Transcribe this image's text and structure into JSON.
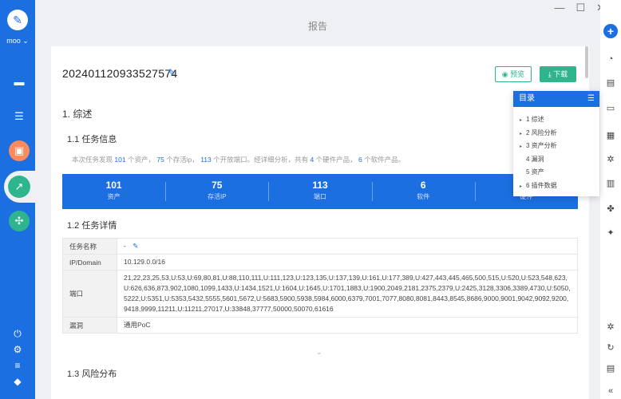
{
  "app": {
    "user": "moo",
    "page_title": "报告",
    "window": {
      "minimize": "—",
      "maximize": "☐",
      "close": "✕"
    }
  },
  "report": {
    "id": "202401120933527574",
    "preview_label": "预览",
    "download_label": "下载",
    "section1": "1. 综述",
    "section1_1": "1.1 任务信息",
    "summary": {
      "p1": "本次任务发现",
      "assets": "101",
      "p2": "个资产，",
      "live_ips": "75",
      "p3": "个存活ip，",
      "ports": "113",
      "p4": "个开放端口。经详细分析，共有",
      "hardware": "4",
      "p5": "个硬件产品，",
      "software": "6",
      "p6": "个软件产品。"
    },
    "stats": [
      {
        "value": "101",
        "label": "资产"
      },
      {
        "value": "75",
        "label": "存活IP"
      },
      {
        "value": "113",
        "label": "端口"
      },
      {
        "value": "6",
        "label": "软件"
      },
      {
        "value": "4",
        "label": "硬件"
      }
    ],
    "section1_2": "1.2 任务详情",
    "details": {
      "task_name_key": "任务名称",
      "task_name_val": "-",
      "ip_key": "IP/Domain",
      "ip_val": "10.129.0.0/16",
      "port_key": "端口",
      "port_val": "21,22,23,25,53,U:53,U:69,80,81,U:88,110,111,U:111,123,U:123,135,U:137,139,U:161,U:177,389,U:427,443,445,465,500,515,U:520,U:523,548,623,U:626,636,873,902,1080,1099,1433,U:1434,1521,U:1604,U:1645,U:1701,1883,U:1900,2049,2181,2375,2379,U:2425,3128,3306,3389,4730,U:5050,5222,U:5351,U:5353,5432,5555,5601,5672,U:5683,5900,5938,5984,6000,6379,7001,7077,8080,8081,8443,8545,8686,9000,9001,9042,9092,9200,9418,9999,11211,U:11211,27017,U:33848,37777,50000,50070,61616",
      "vuln_key": "漏洞",
      "vuln_val": "通用PoC"
    },
    "section1_3": "1.3 风险分布"
  },
  "toc": {
    "title": "目录",
    "items": [
      {
        "label": "1 综述",
        "expandable": true
      },
      {
        "label": "2 风险分析",
        "expandable": true
      },
      {
        "label": "3 资产分析",
        "expandable": true
      },
      {
        "label": "4 漏洞",
        "expandable": false
      },
      {
        "label": "5 资产",
        "expandable": false
      },
      {
        "label": "6 插件数据",
        "expandable": true
      }
    ]
  },
  "colors": {
    "primary": "#1c6fe0",
    "accent_green": "#2fb58d"
  }
}
